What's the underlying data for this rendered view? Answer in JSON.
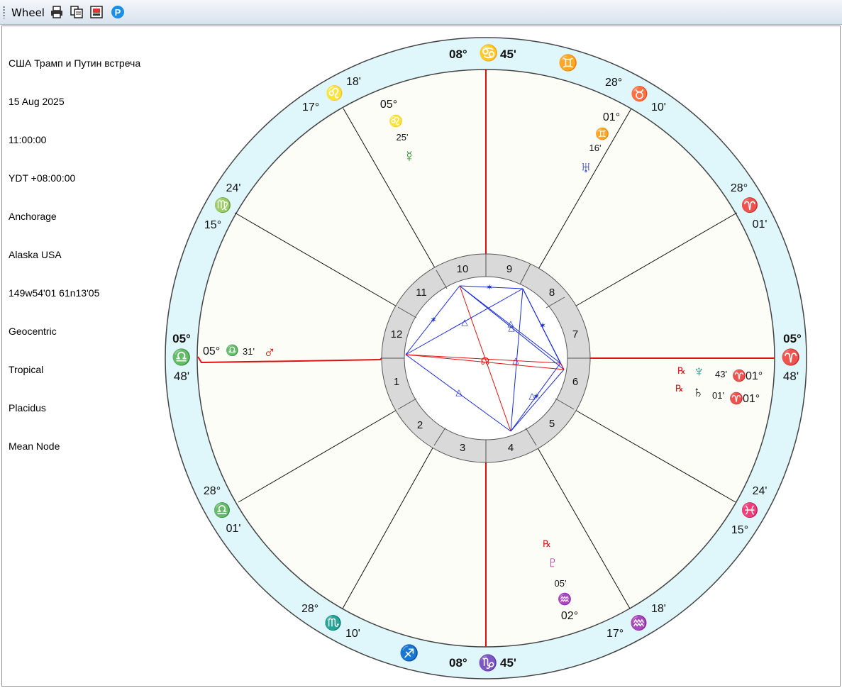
{
  "window": {
    "title": "Wheel",
    "toolbar": {
      "print": "print-icon",
      "copy": "copy-icon",
      "export": "export-image-icon",
      "settings": "p-circle-icon"
    }
  },
  "chart_info": {
    "lines": [
      "США Трамп и Путин встреча",
      "15 Aug 2025",
      "11:00:00",
      "YDT +08:00:00",
      "Anchorage",
      "Alaska USA",
      "149w54'01 61n13'05",
      "Geocentric",
      "Tropical",
      "Placidus",
      "Mean Node"
    ]
  },
  "wheel": {
    "outer_ring_color": "#dff6fb",
    "inner_ring_color": "#d9d9d9",
    "house_numbers": [
      "10",
      "9",
      "8",
      "7",
      "6",
      "5",
      "4",
      "3",
      "2",
      "1",
      "12",
      "11"
    ],
    "cusps": {
      "mc": {
        "deg": "08°",
        "sign": "♋",
        "min": "45'"
      },
      "ic": {
        "deg": "08°",
        "sign": "♑",
        "min": "45'"
      },
      "asc": {
        "deg": "05°",
        "sign": "♎",
        "min": "48'"
      },
      "dsc": {
        "deg": "05°",
        "sign": "♈",
        "min": "48'"
      },
      "c11": {
        "deg": "17°",
        "sign": "♌",
        "min": "18'"
      },
      "c12": {
        "deg": "15°",
        "sign": "♍",
        "min": "24'"
      },
      "c2": {
        "deg": "28°",
        "sign": "♎",
        "min": "01'"
      },
      "c3": {
        "deg": "28°",
        "sign": "♏",
        "min": "10'"
      },
      "c5": {
        "deg": "17°",
        "sign": "♒",
        "min": "18'"
      },
      "c6": {
        "deg": "15°",
        "sign": "♓",
        "min": "24'"
      },
      "c8": {
        "deg": "28°",
        "sign": "♈",
        "min": "01'"
      },
      "c9": {
        "deg": "28°",
        "sign": "♉",
        "min": "10'"
      }
    },
    "intercepted": {
      "gemini": "♊",
      "sagittarius": "♐"
    },
    "planets": {
      "mercury": {
        "glyph": "☿",
        "deg": "05°",
        "sign": "♌",
        "min": "25'"
      },
      "uranus": {
        "glyph": "♅",
        "deg": "01°",
        "sign": "♊",
        "min": "16'"
      },
      "mars": {
        "glyph": "♂",
        "deg": "05°",
        "sign": "♎",
        "min": "31'"
      },
      "neptune": {
        "glyph": "♆",
        "retro": "℞",
        "deg": "01°",
        "sign": "♈",
        "min": "43'"
      },
      "saturn": {
        "glyph": "♄",
        "retro": "℞",
        "deg": "01°",
        "sign": "♈",
        "min": "01'"
      },
      "pluto": {
        "glyph": "♇",
        "retro": "℞",
        "deg": "02°",
        "sign": "♒",
        "min": "05'"
      }
    },
    "aspect_glyphs": {
      "trine": "△",
      "sextile": "✶",
      "node": "☊"
    }
  }
}
